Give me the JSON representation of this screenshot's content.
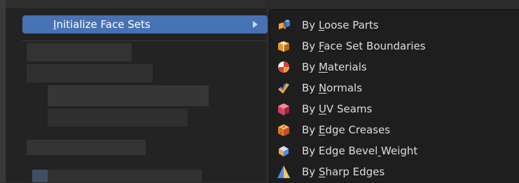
{
  "parent_menu": {
    "item_label": "Initialize Face Sets",
    "item_underline_index": 0
  },
  "submenu": {
    "items": [
      {
        "label": "By Loose Parts",
        "ul": 3,
        "icon": "loose-parts-icon"
      },
      {
        "label": "By Face Set Boundaries",
        "ul": 3,
        "icon": "face-set-boundaries-icon"
      },
      {
        "label": "By Materials",
        "ul": 3,
        "icon": "materials-icon"
      },
      {
        "label": "By Normals",
        "ul": 3,
        "icon": "normals-icon"
      },
      {
        "label": "By UV Seams",
        "ul": 3,
        "icon": "uv-seams-icon"
      },
      {
        "label": "By Edge Creases",
        "ul": 3,
        "icon": "edge-creases-icon"
      },
      {
        "label": "By Edge Bevel Weight",
        "ul": 13,
        "icon": "edge-bevel-weight-icon"
      },
      {
        "label": "By Sharp Edges",
        "ul": 3,
        "icon": "sharp-edges-icon"
      }
    ]
  },
  "colors": {
    "highlight": "#4772b3",
    "menu_bg": "#1e1e1e",
    "text": "#dedede"
  }
}
